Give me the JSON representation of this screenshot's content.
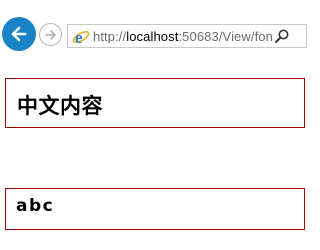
{
  "browser": {
    "address_bar": {
      "url_prefix": "http://",
      "url_host": "localhost",
      "url_rest": ":50683/View/fon"
    }
  },
  "content": {
    "box1_text": "中文内容",
    "box2_text": "abc"
  },
  "colors": {
    "back_button": "#1a83c8",
    "box_border": "#a40000"
  },
  "icons": {
    "back": "back-arrow-icon",
    "forward": "forward-arrow-icon",
    "page": "ie-logo-icon",
    "search": "search-icon"
  }
}
